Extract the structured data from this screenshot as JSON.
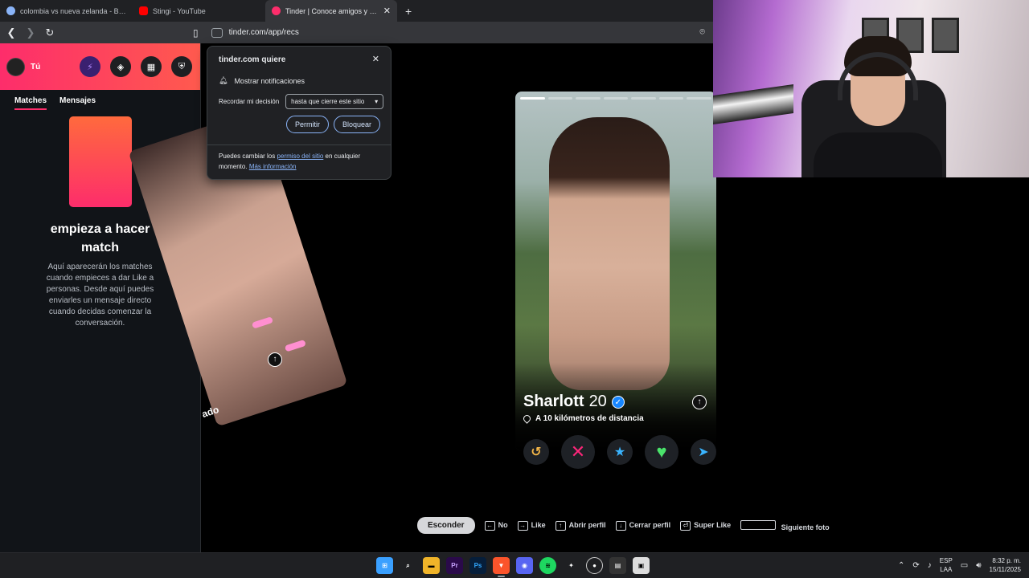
{
  "browser": {
    "tabs": [
      {
        "label": "colombia vs nueva zelanda - Buscar c",
        "favicon_color": "#8ab4f8",
        "active": false
      },
      {
        "label": "Stingi - YouTube",
        "favicon_color": "#ff0000",
        "active": false
      },
      {
        "label": "Tinder | Conoce amigos y gente",
        "favicon_color": "#fd2d6b",
        "active": true
      }
    ],
    "new_tab_symbol": "+",
    "close_symbol": "✕",
    "url": "tinder.com/app/recs"
  },
  "permission_popup": {
    "title": "tinder.com quiere",
    "permission": "Mostrar notificaciones",
    "remember_label": "Recordar mi decisión",
    "remember_value": "hasta que cierre este sitio",
    "allow_label": "Permitir",
    "block_label": "Bloquear",
    "footer_prefix": "Puedes cambiar los",
    "footer_link1": "permiso del sitio",
    "footer_middle": "en cualquier momento.",
    "footer_link2": "Más información"
  },
  "sidebar": {
    "user_label": "Tú",
    "tabs": [
      {
        "label": "Matches",
        "active": true
      },
      {
        "label": "Mensajes",
        "active": false
      }
    ],
    "empty_title": "empieza a hacer match",
    "empty_description": "Aquí aparecerán los matches cuando empieces a dar Like a personas. Desde aquí puedes enviarles un mensaje directo cuando decidas comenzar la conversación.",
    "accent_color": "#fd2d6b"
  },
  "back_card": {
    "partial_text": "ado"
  },
  "profile": {
    "name": "Sharlott",
    "age": "20",
    "distance": "A 10 kilómetros de distancia",
    "photo_count": 7,
    "current_photo": 1
  },
  "shortcuts": {
    "hide_label": "Esconder",
    "items": [
      {
        "key": "←",
        "label": "No"
      },
      {
        "key": "→",
        "label": "Like"
      },
      {
        "key": "↑",
        "label": "Abrir perfil"
      },
      {
        "key": "↓",
        "label": "Cerrar perfil"
      },
      {
        "key": "⏎",
        "label": "Super Like"
      },
      {
        "key": "",
        "label": "Siguiente foto"
      }
    ]
  },
  "taskbar": {
    "language_line1": "ESP",
    "language_line2": "LAA",
    "time": "8:32 p. m.",
    "date": "15/11/2025"
  }
}
